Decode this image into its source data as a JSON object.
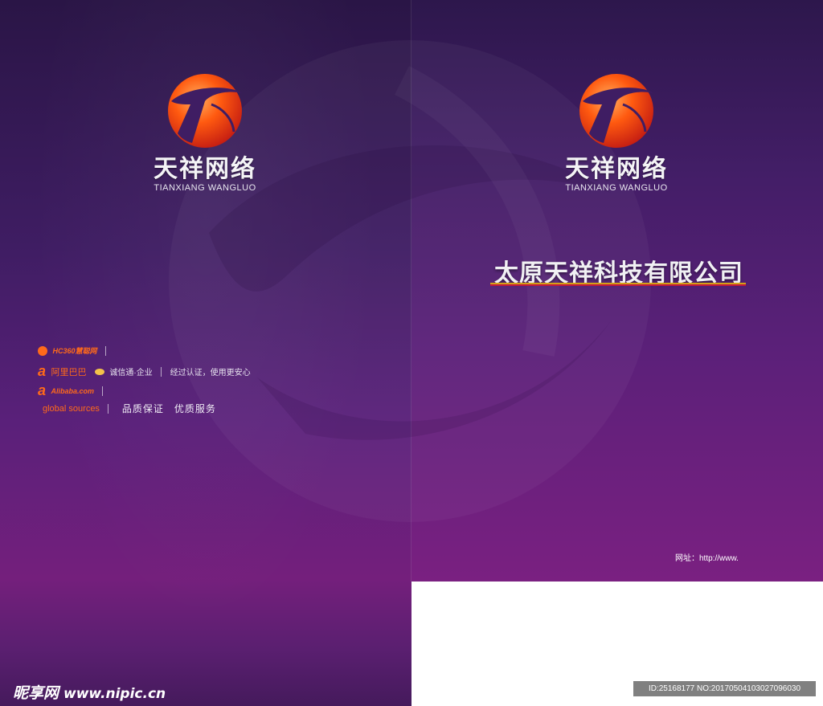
{
  "left_cover": {
    "logo": {
      "name_cn": "天祥网络",
      "name_en": "TIANXIANG WANGLUO"
    },
    "certifications": {
      "hc360": "HC360慧聪网",
      "alibaba_cn": "阿里巴巴",
      "chengxintong": "诚信通·企业",
      "verified_text": "经过认证，使用更安心",
      "alibaba_com": "Alibaba.com",
      "global_sources": "global sources",
      "slogan": "品质保证   优质服务"
    }
  },
  "right_cover": {
    "logo": {
      "name_cn": "天祥网络",
      "name_en": "TIANXIANG WANGLUO"
    },
    "company_name": "太原天祥科技有限公司",
    "website": "网址：http://www."
  },
  "watermark": {
    "site_cn": "昵享网",
    "site_url": "www.nipic.cn",
    "image_id": "ID:25168177 NO:20170504103027096030"
  },
  "colors": {
    "purple_dark": "#2d174c",
    "purple_mid": "#5b2079",
    "magenta": "#7a2081",
    "logo_orange": "#ff5a10",
    "logo_red": "#d0201a"
  }
}
